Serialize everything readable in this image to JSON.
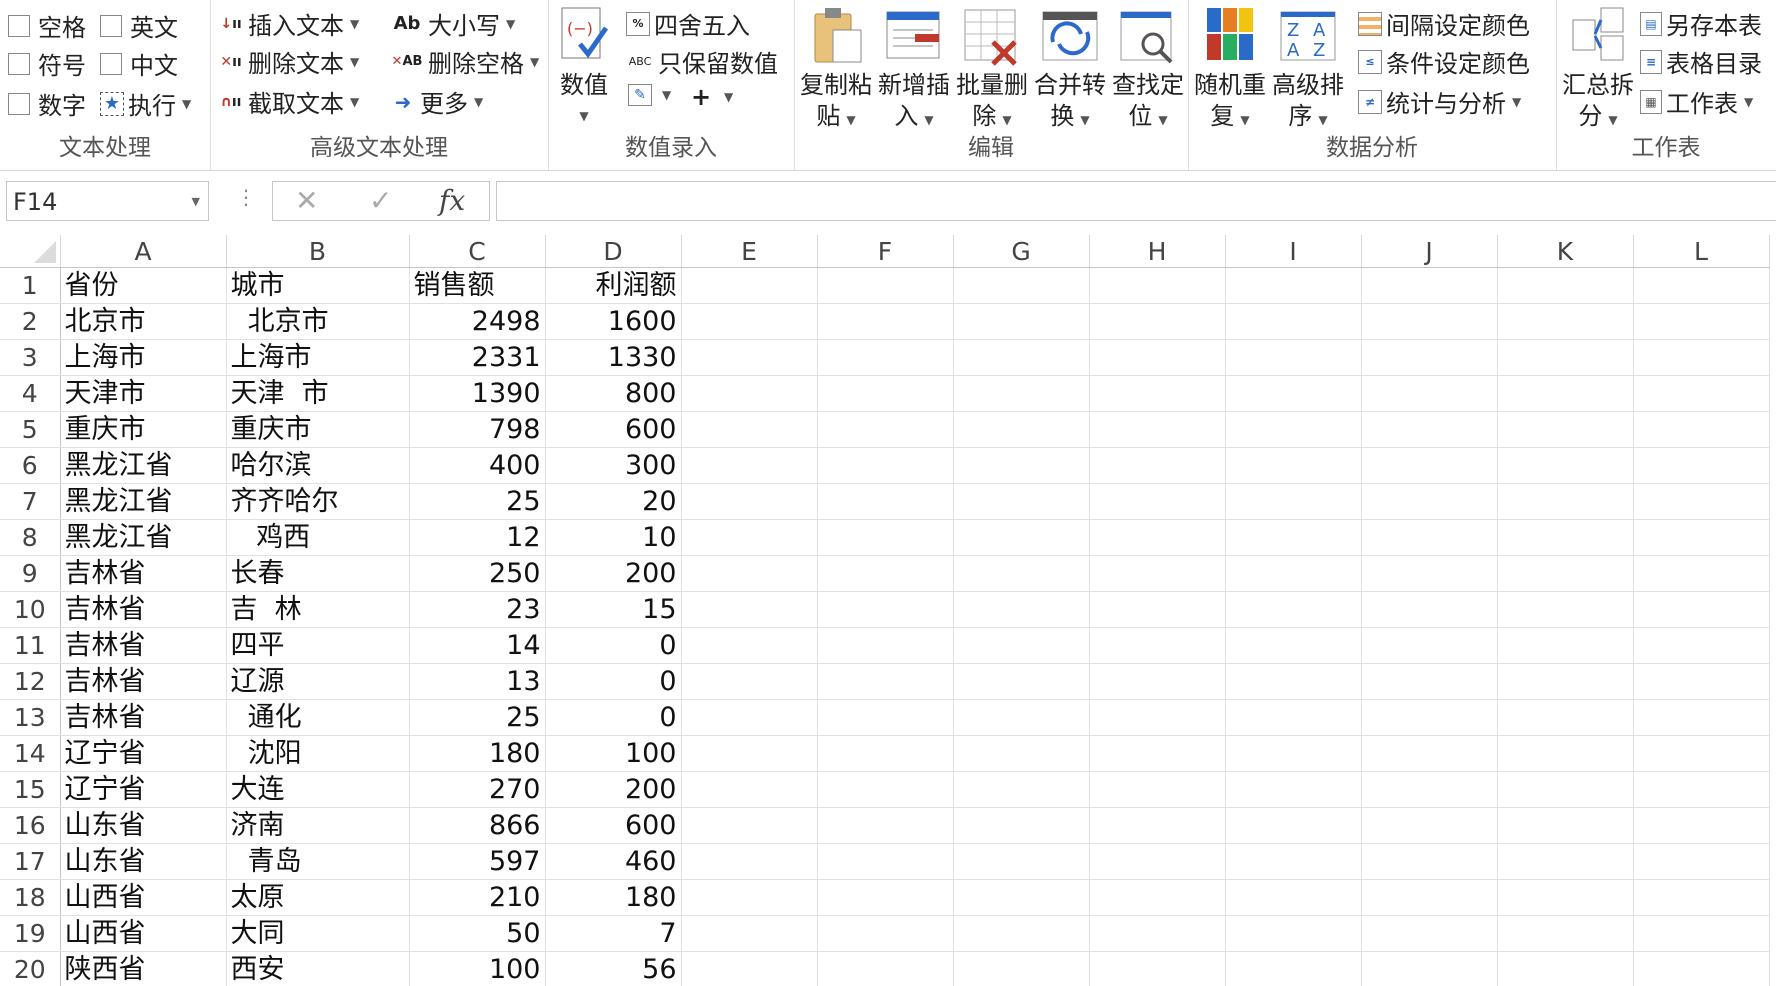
{
  "ribbon": {
    "text_group": {
      "title": "文本处理",
      "items": [
        {
          "label": "空格"
        },
        {
          "label": "英文"
        },
        {
          "label": "符号"
        },
        {
          "label": "中文"
        },
        {
          "label": "数字"
        },
        {
          "label": "执行"
        }
      ]
    },
    "adv_text_group": {
      "title": "高级文本处理",
      "items": [
        {
          "label": "插入文本"
        },
        {
          "label": "大小写"
        },
        {
          "label": "删除文本"
        },
        {
          "label": "删除空格"
        },
        {
          "label": "截取文本"
        },
        {
          "label": "更多"
        }
      ]
    },
    "number_group": {
      "title": "数值录入",
      "big_label": "数值",
      "round_label": "四舍五入",
      "keep_label": "只保留数值"
    },
    "edit_group": {
      "title": "编辑",
      "buttons": [
        {
          "line1": "复制粘",
          "line2": "贴"
        },
        {
          "line1": "新增插",
          "line2": "入"
        },
        {
          "line1": "批量删",
          "line2": "除"
        },
        {
          "line1": "合并转",
          "line2": "换"
        },
        {
          "line1": "查找定",
          "line2": "位"
        }
      ]
    },
    "analysis_group": {
      "title": "数据分析",
      "buttons": [
        {
          "line1": "随机重",
          "line2": "复"
        },
        {
          "line1": "高级排",
          "line2": "序"
        }
      ],
      "items": [
        {
          "label": "间隔设定颜色"
        },
        {
          "label": "条件设定颜色"
        },
        {
          "label": "统计与分析"
        }
      ]
    },
    "sheet_group": {
      "title": "工作表",
      "big": {
        "line1": "汇总拆",
        "line2": "分"
      },
      "items": [
        {
          "label": "另存本表"
        },
        {
          "label": "表格目录"
        },
        {
          "label": "工作表"
        }
      ]
    }
  },
  "formula_bar": {
    "name_box": "F14",
    "fx": "fx",
    "formula": ""
  },
  "sheet": {
    "columns": [
      "A",
      "B",
      "C",
      "D",
      "E",
      "F",
      "G",
      "H",
      "I",
      "J",
      "K",
      "L"
    ],
    "rows": [
      {
        "n": "1",
        "a": "省份",
        "b": "城市",
        "c": "销售额",
        "d": "利润额"
      },
      {
        "n": "2",
        "a": "北京市",
        "b": "  北京市",
        "c": "2498",
        "d": "1600"
      },
      {
        "n": "3",
        "a": "上海市",
        "b": "上海市",
        "c": "2331",
        "d": "1330"
      },
      {
        "n": "4",
        "a": "天津市",
        "b": "天津  市",
        "c": "1390",
        "d": "800"
      },
      {
        "n": "5",
        "a": "重庆市",
        "b": "重庆市",
        "c": "798",
        "d": "600"
      },
      {
        "n": "6",
        "a": "黑龙江省",
        "b": "哈尔滨",
        "c": "400",
        "d": "300"
      },
      {
        "n": "7",
        "a": "黑龙江省",
        "b": "齐齐哈尔",
        "c": "25",
        "d": "20"
      },
      {
        "n": "8",
        "a": "黑龙江省",
        "b": "   鸡西",
        "c": "12",
        "d": "10"
      },
      {
        "n": "9",
        "a": "吉林省",
        "b": "长春",
        "c": "250",
        "d": "200"
      },
      {
        "n": "10",
        "a": "吉林省",
        "b": "吉  林",
        "c": "23",
        "d": "15"
      },
      {
        "n": "11",
        "a": "吉林省",
        "b": "四平",
        "c": "14",
        "d": "0"
      },
      {
        "n": "12",
        "a": "吉林省",
        "b": "辽源",
        "c": "13",
        "d": "0"
      },
      {
        "n": "13",
        "a": "吉林省",
        "b": "  通化",
        "c": "25",
        "d": "0"
      },
      {
        "n": "14",
        "a": "辽宁省",
        "b": "  沈阳",
        "c": "180",
        "d": "100"
      },
      {
        "n": "15",
        "a": "辽宁省",
        "b": "大连",
        "c": "270",
        "d": "200"
      },
      {
        "n": "16",
        "a": "山东省",
        "b": "济南",
        "c": "866",
        "d": "600"
      },
      {
        "n": "17",
        "a": "山东省",
        "b": "  青岛",
        "c": "597",
        "d": "460"
      },
      {
        "n": "18",
        "a": "山西省",
        "b": "太原",
        "c": "210",
        "d": "180"
      },
      {
        "n": "19",
        "a": "山西省",
        "b": "大同",
        "c": "50",
        "d": "7"
      },
      {
        "n": "20",
        "a": "陕西省",
        "b": "西安",
        "c": "100",
        "d": "56"
      }
    ]
  }
}
